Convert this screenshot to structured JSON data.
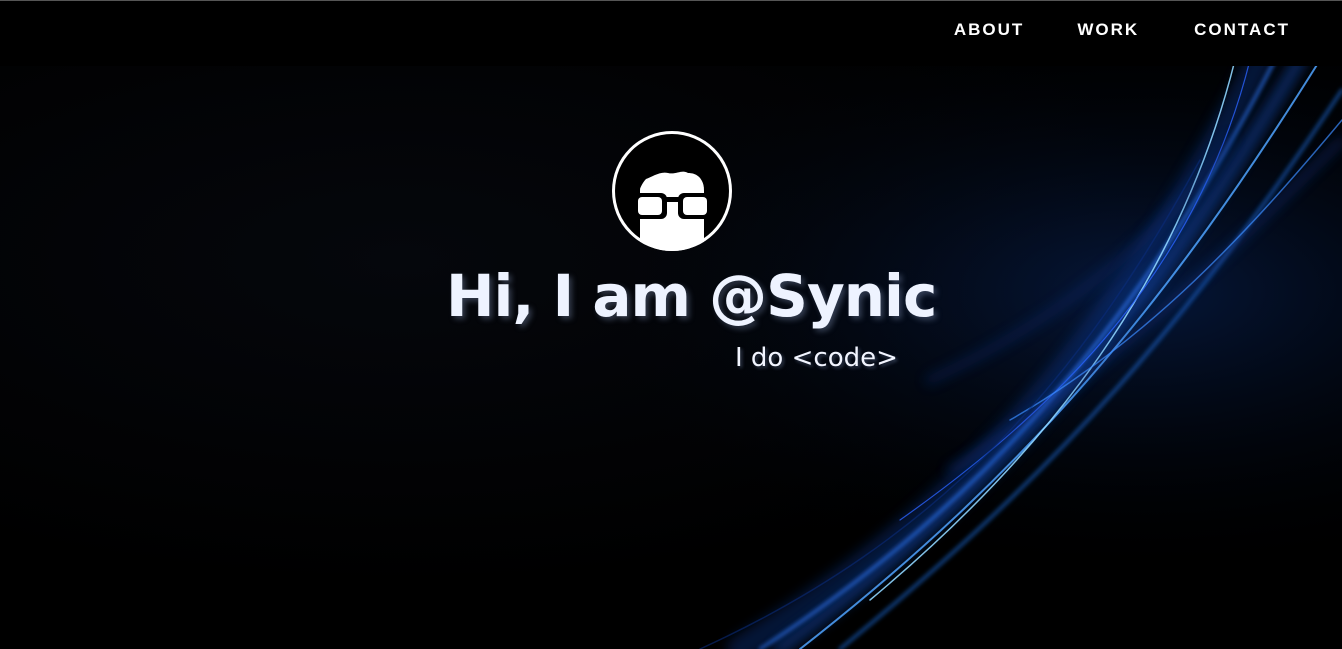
{
  "nav": {
    "items": [
      {
        "label": "ABOUT"
      },
      {
        "label": "WORK"
      },
      {
        "label": "CONTACT"
      }
    ]
  },
  "hero": {
    "avatar_icon": "nerd-glasses-avatar-icon",
    "headline": "Hi, I am @Synic",
    "tagline": "I do <code>"
  },
  "colors": {
    "background": "#000000",
    "text": "#ffffff",
    "accent_swoosh": "#1e6fe0"
  }
}
